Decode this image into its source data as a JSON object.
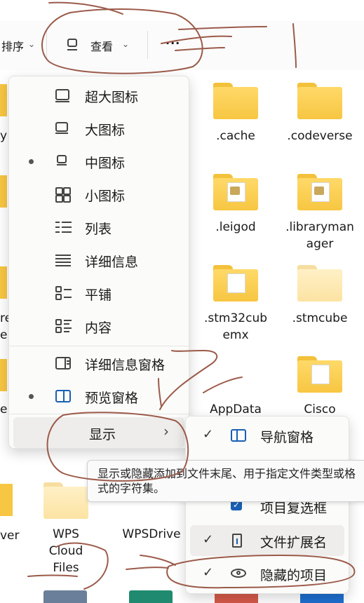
{
  "toolbar": {
    "sort_label": "排序",
    "view_label": "查看",
    "more_label": "..."
  },
  "left_column": {
    "fragment_1": "y",
    "fragment_2": "re",
    "fragment_3": "e",
    "fragment_4": "e",
    "fragment_5": "ver"
  },
  "files": [
    {
      "name": ".cache"
    },
    {
      "name": ".codeverse"
    },
    {
      "name": ".leigod"
    },
    {
      "name": ".librarymanager"
    },
    {
      "name": ".stm32cubemx"
    },
    {
      "name": ".stmcube"
    },
    {
      "name": "AppData"
    },
    {
      "name": "Cisco"
    },
    {
      "name": "WPS Cloud Files"
    },
    {
      "name": "WPSDrive"
    }
  ],
  "view_menu": {
    "items": [
      {
        "label": "超大图标",
        "icon": "monitor-large-icon",
        "selected": false
      },
      {
        "label": "大图标",
        "icon": "monitor-icon",
        "selected": false
      },
      {
        "label": "中图标",
        "icon": "monitor-small-icon",
        "selected": true
      },
      {
        "label": "小图标",
        "icon": "grid-icon",
        "selected": false
      },
      {
        "label": "列表",
        "icon": "list-icon",
        "selected": false
      },
      {
        "label": "详细信息",
        "icon": "details-icon",
        "selected": false
      },
      {
        "label": "平铺",
        "icon": "tiles-icon",
        "selected": false
      },
      {
        "label": "内容",
        "icon": "content-icon",
        "selected": false
      },
      {
        "label": "详细信息窗格",
        "icon": "details-pane-icon",
        "selected": false
      },
      {
        "label": "预览窗格",
        "icon": "preview-pane-icon",
        "selected": true
      },
      {
        "label": "显示",
        "icon": "",
        "selected": false
      }
    ],
    "show_chevron": "›"
  },
  "show_submenu": {
    "items": [
      {
        "label": "导航窗格",
        "icon": "navigation-pane-icon",
        "checked": true
      },
      {
        "label": "项目复选框",
        "icon": "checkbox-icon",
        "checked": true
      },
      {
        "label": "文件扩展名",
        "icon": "file-extension-icon",
        "checked": true
      },
      {
        "label": "隐藏的项目",
        "icon": "eye-icon",
        "checked": true
      }
    ],
    "check_mark": "✓"
  },
  "tooltip": {
    "text": "显示或隐藏添加到文件末尾、用于指定文件类型或格式的字符集。"
  },
  "colors": {
    "accent": "#0067c0",
    "folder": "#f7c642",
    "scribble": "#9b5a4a"
  }
}
